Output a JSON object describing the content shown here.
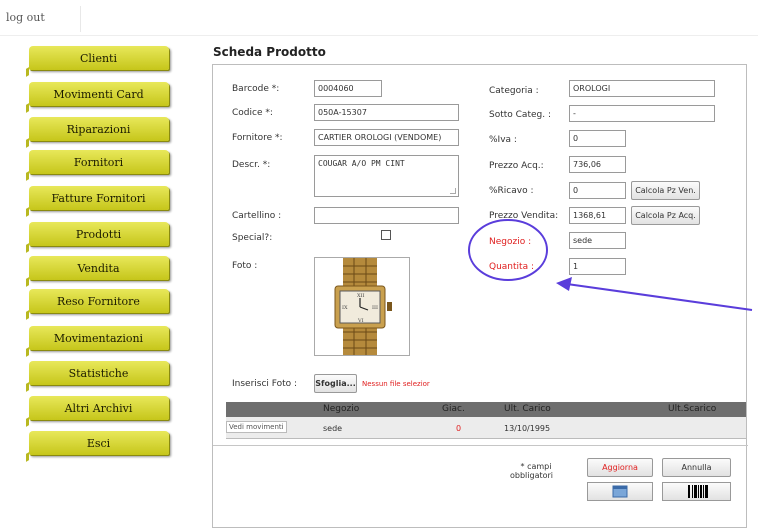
{
  "topbar": {
    "logout_label": "log out"
  },
  "sidebar": {
    "items": [
      {
        "label": "Clienti"
      },
      {
        "label": "Movimenti Card"
      },
      {
        "label": "Riparazioni"
      },
      {
        "label": "Fornitori"
      },
      {
        "label": "Fatture Fornitori"
      },
      {
        "label": "Prodotti"
      },
      {
        "label": "Vendita"
      },
      {
        "label": "Reso Fornitore"
      },
      {
        "label": "Movimentazioni"
      },
      {
        "label": "Statistiche"
      },
      {
        "label": "Altri Archivi"
      },
      {
        "label": "Esci"
      }
    ]
  },
  "page": {
    "title": "Scheda Prodotto"
  },
  "form": {
    "barcode": {
      "label": "Barcode *:",
      "value": "0004060"
    },
    "codice": {
      "label": "Codice *:",
      "value": "050A-15307"
    },
    "fornitore": {
      "label": "Fornitore *:",
      "value": "CARTIER OROLOGI (VENDOME)"
    },
    "descr": {
      "label": "Descr. *:",
      "value": "COUGAR A/O PM CINT"
    },
    "cartellino": {
      "label": "Cartellino :",
      "value": ""
    },
    "special": {
      "label": "Special?:"
    },
    "foto": {
      "label": "Foto :"
    },
    "categoria": {
      "label": "Categoria :",
      "value": "OROLOGI"
    },
    "sotto_categ": {
      "label": "Sotto Categ. :",
      "value": "-"
    },
    "iva": {
      "label": "%Iva :",
      "value": "0"
    },
    "prezzo_acq": {
      "label": "Prezzo Acq.:",
      "value": "736,06"
    },
    "ricavo": {
      "label": "%Ricavo :",
      "value": "0"
    },
    "prezzo_vendita": {
      "label": "Prezzo Vendita:",
      "value": "1368,61"
    },
    "negozio": {
      "label": "Negozio :",
      "value": "sede"
    },
    "quantita": {
      "label": "Quantita :",
      "value": "1"
    },
    "calc_ven_label": "Calcola Pz Ven.",
    "calc_acq_label": "Calcola Pz Acq.",
    "inserisci_foto_label": "Inserisci Foto :",
    "sfoglia_label": "Sfoglia...",
    "no_file_label": "Nessun file selezior"
  },
  "movements": {
    "headers": [
      "Negozio",
      "Giac.",
      "Ult. Carico",
      "Ult.Scarico"
    ],
    "rows": [
      {
        "link": "Vedi movimenti",
        "negozio": "sede",
        "giac": "0",
        "ult_carico": "13/10/1995",
        "ult_scarico": ""
      }
    ]
  },
  "footer": {
    "required_note_1": "* campi",
    "required_note_2": "obbligatori",
    "aggiorna_label": "Aggiorna",
    "annulla_label": "Annulla"
  },
  "colors": {
    "nav_button": "#d6d630",
    "required_red": "#e02020",
    "annotation": "#5a3ddb"
  },
  "icons": [
    "calendar-icon",
    "barcode-icon",
    "watch-photo"
  ]
}
